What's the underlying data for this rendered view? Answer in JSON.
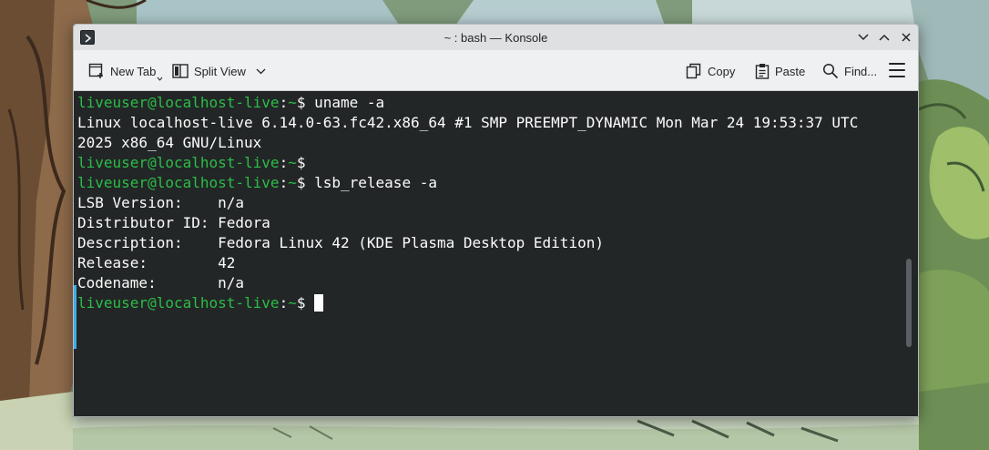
{
  "window": {
    "title": "~ : bash — Konsole"
  },
  "toolbar": {
    "new_tab_label": "New Tab",
    "split_view_label": "Split View",
    "copy_label": "Copy",
    "paste_label": "Paste",
    "find_label": "Find..."
  },
  "terminal": {
    "prompt_user": "liveuser@localhost-live",
    "prompt_sep": ":",
    "prompt_path": "~",
    "prompt_end": "$ ",
    "lines": [
      {
        "type": "prompt",
        "cmd": "uname -a"
      },
      {
        "type": "output",
        "text": "Linux localhost-live 6.14.0-63.fc42.x86_64 #1 SMP PREEMPT_DYNAMIC Mon Mar 24 19:53:37 UTC"
      },
      {
        "type": "output",
        "text": "2025 x86_64 GNU/Linux"
      },
      {
        "type": "prompt",
        "cmd": ""
      },
      {
        "type": "prompt",
        "cmd": "lsb_release -a"
      },
      {
        "type": "output",
        "text": "LSB Version:    n/a"
      },
      {
        "type": "output",
        "text": "Distributor ID: Fedora"
      },
      {
        "type": "output",
        "text": "Description:    Fedora Linux 42 (KDE Plasma Desktop Edition)"
      },
      {
        "type": "output",
        "text": "Release:        42"
      },
      {
        "type": "output",
        "text": "Codename:       n/a"
      }
    ]
  },
  "colors": {
    "prompt_user": "#2bbd47",
    "terminal_bg": "#232627",
    "terminal_fg": "#fcfcfc",
    "accent": "#3daee9"
  }
}
